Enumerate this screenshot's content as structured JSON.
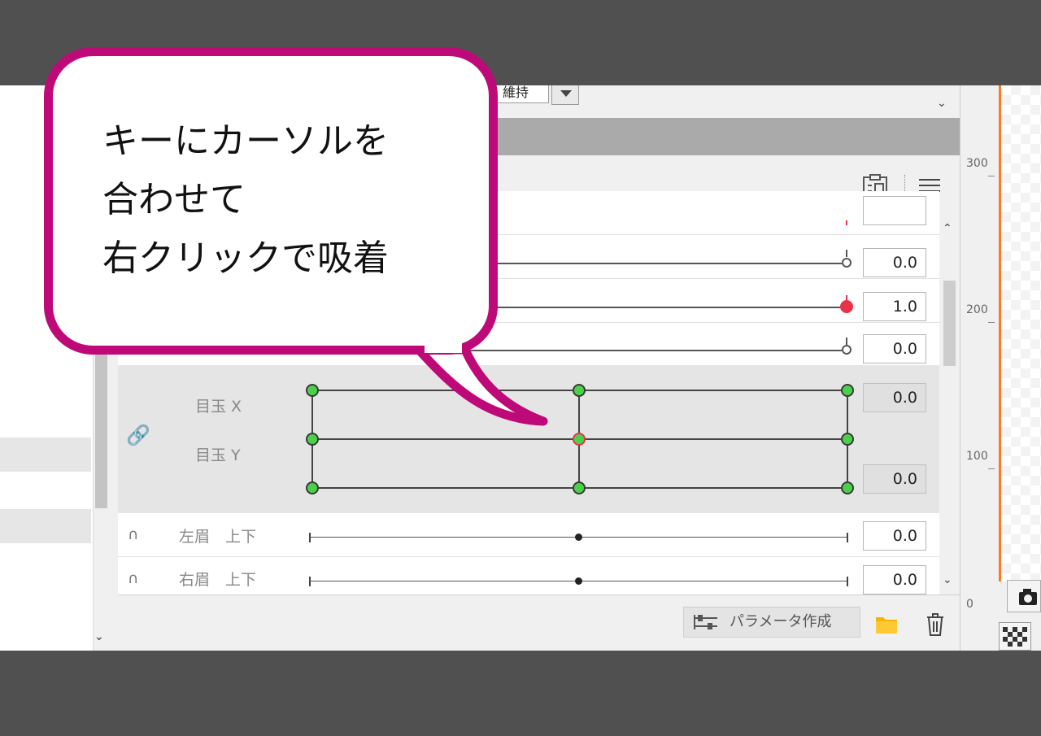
{
  "callout": {
    "lines": [
      "キーにカーソルを",
      "合わせて",
      "右クリックで吸着"
    ]
  },
  "top": {
    "hold_value": "維持"
  },
  "params": {
    "rows": [
      {
        "value": "0.0"
      },
      {
        "value": "1.0"
      },
      {
        "value": "0.0"
      }
    ],
    "combo": {
      "name_x": "目玉 X",
      "name_y": "目玉 Y",
      "value_x": "0.0",
      "value_y": "0.0"
    },
    "brow_left": {
      "name": "左眉　上下",
      "value": "0.0"
    },
    "brow_right": {
      "name": "右眉　上下",
      "value": "0.0"
    }
  },
  "bottom": {
    "create_param_label": "パラメータ作成"
  },
  "ruler": {
    "labels": [
      "300",
      "200",
      "100",
      "0"
    ]
  },
  "colors": {
    "callout_border": "#be0a78",
    "key_green": "#4ad14a",
    "key_red": "#e8334a",
    "canvas_border": "#ff7a1a",
    "folder": "#f5b400"
  }
}
